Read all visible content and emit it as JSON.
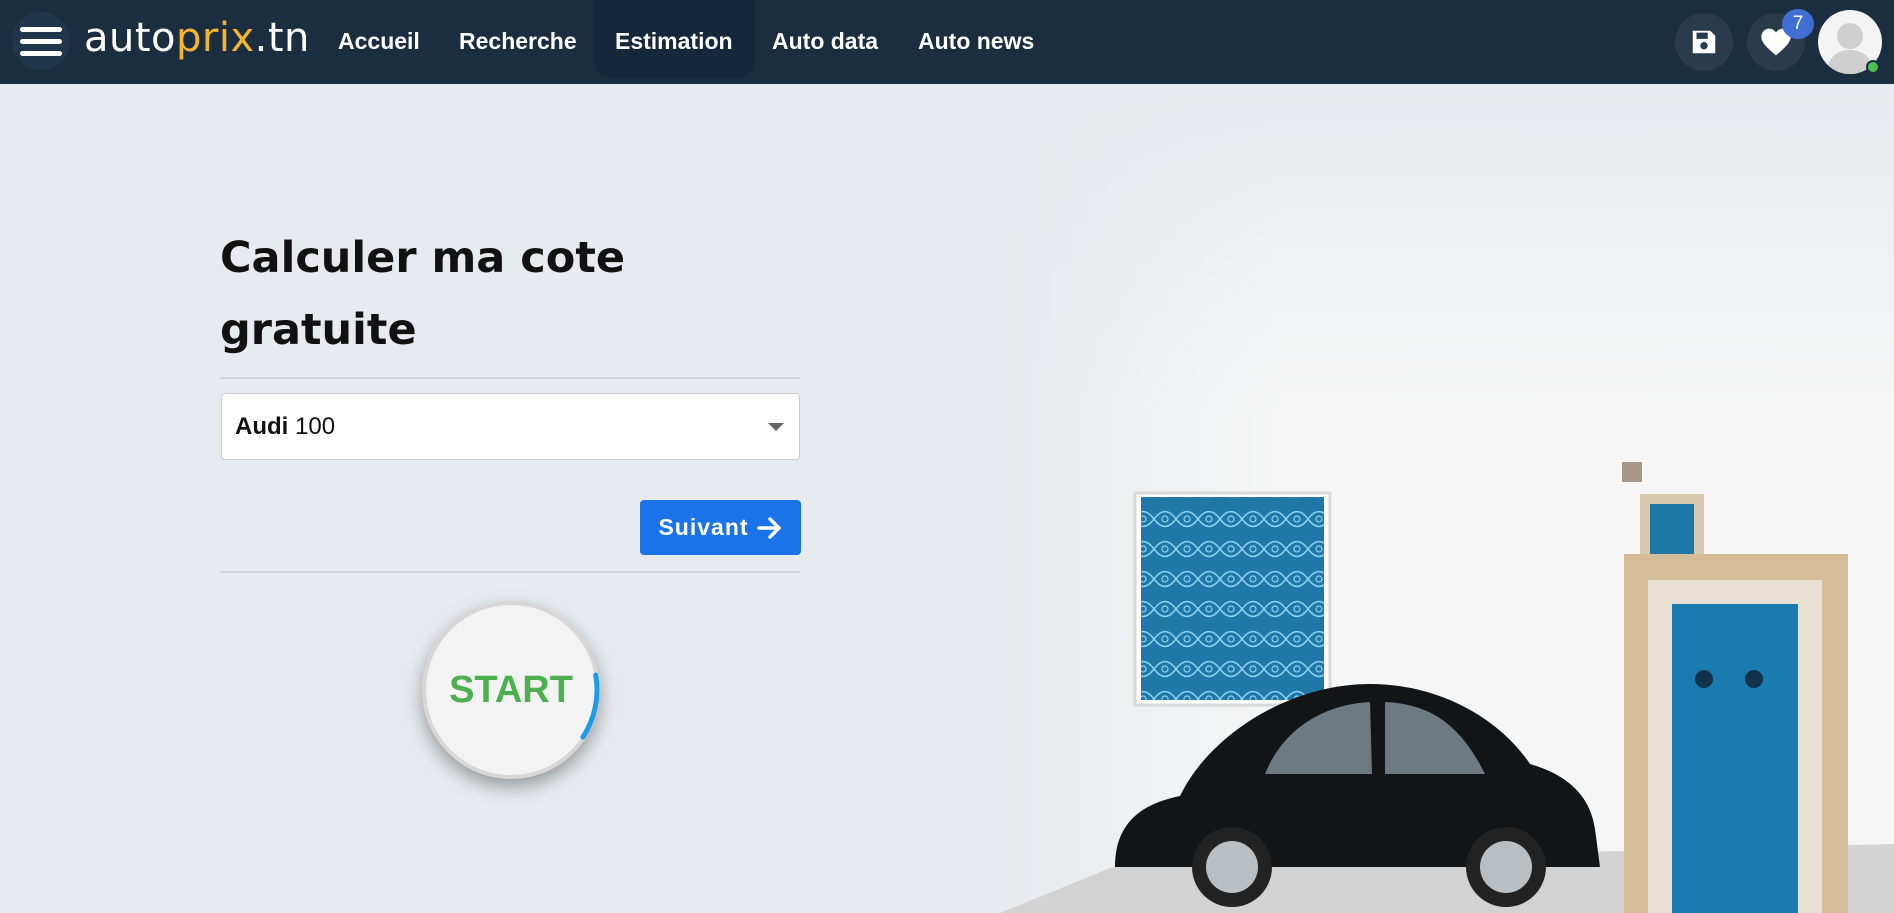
{
  "header": {
    "logo": {
      "part1": "auto",
      "part2": "prix",
      "part3": ".tn"
    },
    "nav": [
      {
        "label": "Accueil",
        "active": false
      },
      {
        "label": "Recherche",
        "active": false
      },
      {
        "label": "Estimation",
        "active": true
      },
      {
        "label": "Auto data",
        "active": false
      },
      {
        "label": "Auto news",
        "active": false
      }
    ],
    "favorites_count": "7",
    "icons": [
      "menu-icon",
      "save-icon",
      "heart-icon",
      "avatar-icon"
    ]
  },
  "main": {
    "title": "Calculer ma cote gratuite",
    "select": {
      "brand": "Audi",
      "model": "100"
    },
    "next_label": "Suivant",
    "start_label": "START",
    "start_progress": 0.12
  },
  "colors": {
    "navbar": "#1b2e40",
    "accent": "#f3b52d",
    "primary": "#1a73e8",
    "start": "#4caf50"
  }
}
